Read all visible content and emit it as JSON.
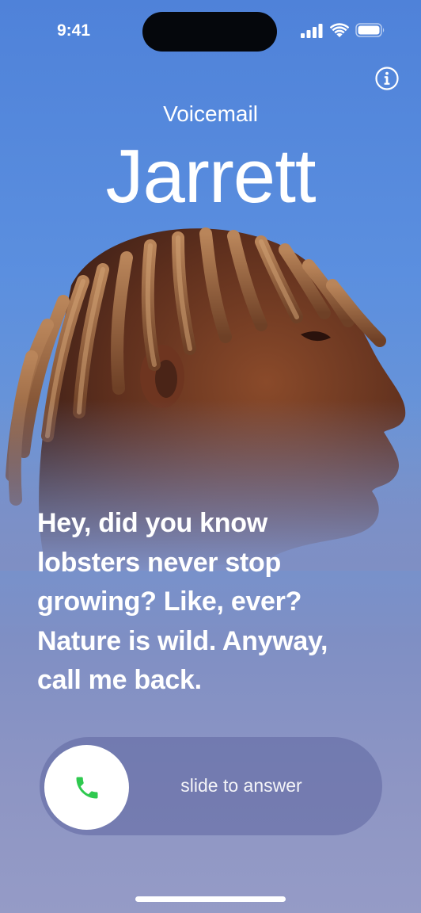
{
  "status_bar": {
    "time": "9:41"
  },
  "header": {
    "subtitle": "Voicemail",
    "caller_name": "Jarrett"
  },
  "transcript": {
    "lines": [
      "Hey, did you know",
      "lobsters never stop",
      "growing? Like, ever?",
      "Nature is wild. Anyway,",
      "call me back."
    ]
  },
  "answer_slider": {
    "label": "slide to answer",
    "accent_color": "#2fc94f"
  },
  "icons": {
    "info": "info-icon",
    "phone": "phone-icon",
    "signal": "signal-icon",
    "wifi": "wifi-icon",
    "battery": "battery-icon"
  }
}
